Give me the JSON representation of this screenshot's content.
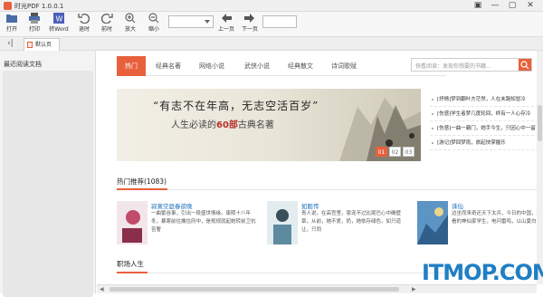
{
  "window": {
    "title": "时光PDF 1.0.0.1",
    "min": "—",
    "restore": "▢",
    "close": "✕",
    "skin": "▣"
  },
  "toolbar": {
    "open": "打开",
    "print": "打印",
    "to_word": "转Word",
    "back": "退时",
    "forward": "前时",
    "zoom_in": "放大",
    "zoom_out": "缩小",
    "prev_page": "上一页",
    "next_page": "下一页",
    "zoom_value": "",
    "page_value": ""
  },
  "tabs": {
    "default_tab": "默认页"
  },
  "sidebar": {
    "heading": "最近阅读文档"
  },
  "nav": {
    "items": [
      "热门",
      "经典名著",
      "网络小说",
      "武侠小说",
      "经典散文",
      "诗词歌赋"
    ],
    "search_placeholder": "快看阅读：发现你想要的书籍..."
  },
  "banner": {
    "headline": "“有志不在年高，无志空活百岁”",
    "sub_prefix": "人生必读的",
    "sub_bold": "60部",
    "sub_suffix": "古典名著",
    "pages": [
      "01",
      "02",
      "03"
    ]
  },
  "news": [
    "[抒情]梦到翻叶方茫然，人在末路知冒冷",
    "[伤感]学生者梦几度轮回，终有一人心存冷",
    "[伤感]一曲一霸门，她手今生，只因心中一留",
    "[游记]梦回梦雨，旅起快掌握乐"
  ],
  "hot": {
    "title": "热门推荐(1083)",
    "books": [
      {
        "title": "寂寞空庭春欲晚",
        "desc": "一曲繁谷事，引出一段盛世情缘。康熙十八年冬，暴寒前往擒住府中，是规规就起她转前卫抗苦奢"
      },
      {
        "title": "如懿传",
        "desc": "青人说，在高宫里，恩宠不过比尾巴心中确壁章，从前，她不爱，奶，她依存绿色，如只道让，只同"
      },
      {
        "title": "诛仙",
        "desc": "边坐而来奇还天下太兵，今日的中国，有着数不看的神仙家学生，电闪雷鸣，以山夏白，多大"
      }
    ]
  },
  "section2": {
    "title": "职场人生"
  },
  "watermark": "ITMOP.COM"
}
